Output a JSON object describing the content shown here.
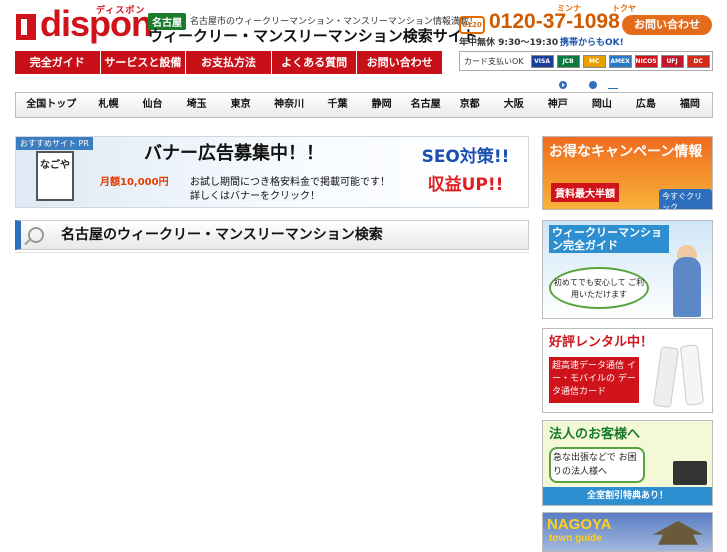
{
  "header": {
    "logo_text": "dispon",
    "logo_kana": "ディスポン",
    "city_badge": "名古屋",
    "tagline": "名古屋市のウィークリーマンション・マンスリーマンション情報満載！",
    "site_title": "ウィークリー・マンスリーマンション検索サイト",
    "free_dial_label": "0120",
    "phone_kana_1": "ミンナ",
    "phone_kana_2": "トクヤ",
    "phone_number": "0120-37-1098",
    "hours": "年中無休 9:30〜19:30",
    "hours_note": "携帯からもOK!",
    "contact_button": "お問い合わせ"
  },
  "main_nav": [
    "完全ガイド",
    "サービスと設備",
    "お支払方法",
    "よくある質問",
    "お問い合わせ"
  ],
  "payment": {
    "label": "カード支払いOK",
    "cards": [
      {
        "name": "VISA",
        "color": "#1a3f9a"
      },
      {
        "name": "JCB",
        "color": "#0b7a3e"
      },
      {
        "name": "MC",
        "color": "#e8a000"
      },
      {
        "name": "AMEX",
        "color": "#2a78c8"
      },
      {
        "name": "NICOS",
        "color": "#d0121b"
      },
      {
        "name": "UFJ",
        "color": "#c2182a"
      },
      {
        "name": "DC",
        "color": "#d42a1a"
      }
    ]
  },
  "region_nav": [
    "全国トップ",
    "札幌",
    "仙台",
    "埼玉",
    "東京",
    "神奈川",
    "千葉",
    "静岡",
    "名古屋",
    "京都",
    "大阪",
    "神戸",
    "岡山",
    "広島",
    "福岡"
  ],
  "banner": {
    "pr_label": "おすすめサイト PR",
    "station_sign": "なごや",
    "headline": "バナー広告募集中！！",
    "price": "月額10,000円",
    "sub1": "お試し期間につき格安料金で掲載可能です！",
    "sub2": "詳しくはバナーをクリック！",
    "seo_line1": "SEO対策!!",
    "seo_line2": "収益UP!!"
  },
  "search_heading": "名古屋のウィークリー・マンスリーマンション検索",
  "sidebar": {
    "campaign_title": "お得なキャンペーン情報",
    "campaign_sub": "賃料最大半額",
    "campaign_button": "今すぐクリック",
    "guide_title": "ウィークリーマンション完全ガイド",
    "guide_bubble": "初めてでも安心して ご利用いただけます",
    "rental_title": "好評レンタル中！",
    "rental_text": "超高速データ通信 イー・モバイルの データ通信カード",
    "corp_title": "法人のお客様へ",
    "corp_bubble": "急な出張などで お困りの法人様へ",
    "corp_bar": "全室割引特典あり！",
    "nagoya_title": "NAGOYA",
    "nagoya_sub": "town guide"
  },
  "colors": {
    "brand_red": "#d0121b",
    "accent_orange": "#e46b1a",
    "link_blue": "#2d6fbd"
  }
}
